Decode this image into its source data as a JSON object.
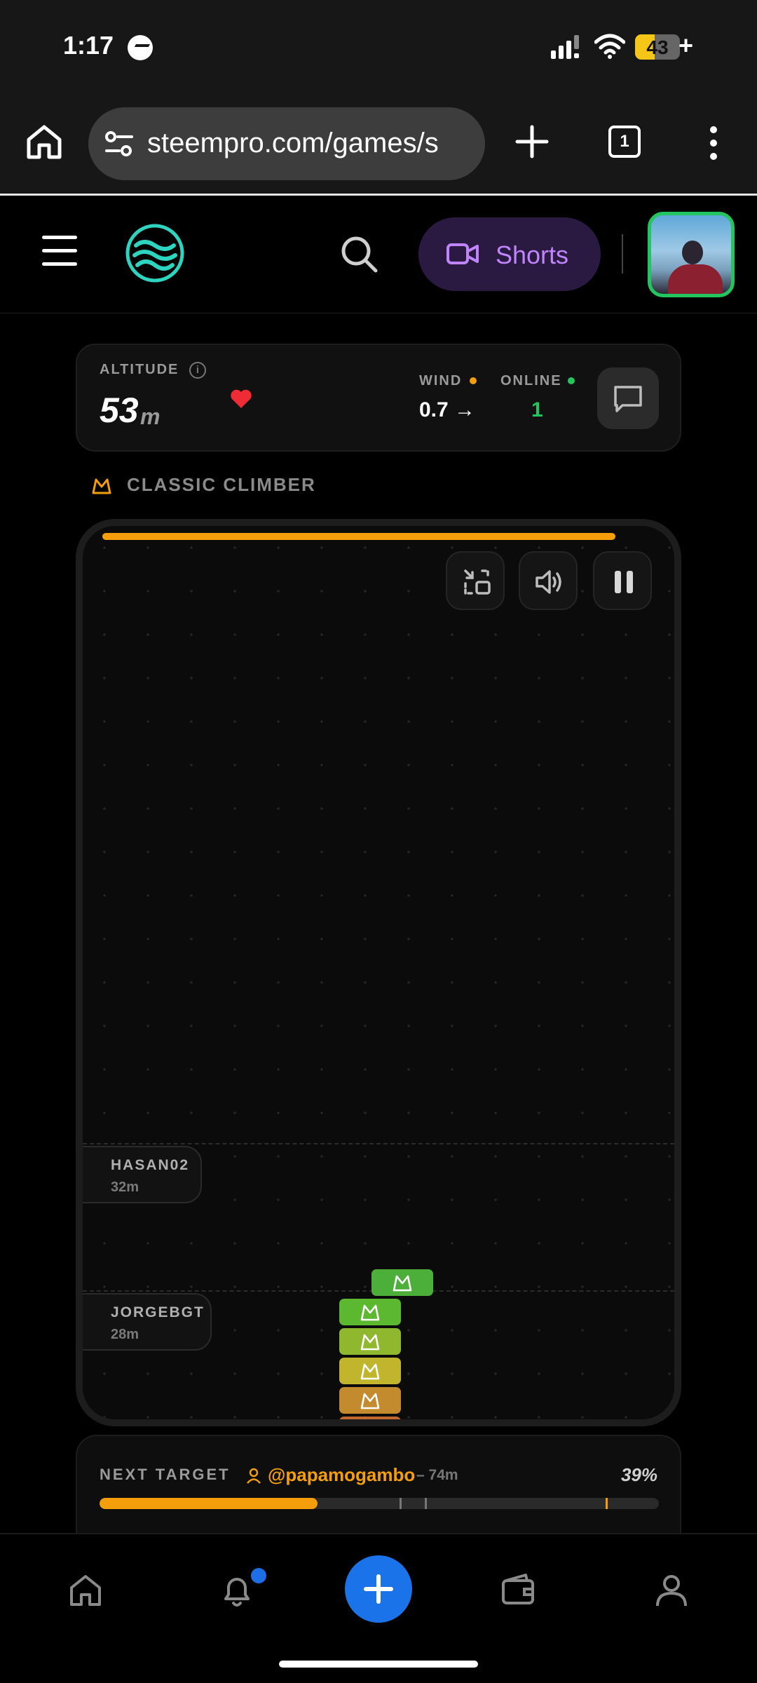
{
  "status_bar": {
    "time": "1:17",
    "battery": "43",
    "battery_suffix": "+"
  },
  "browser": {
    "url": "steempro.com/games/s",
    "tab_count": "1"
  },
  "header": {
    "shorts_label": "Shorts",
    "icons": [
      "menu-icon",
      "app-logo",
      "search-icon",
      "video-icon",
      "avatar"
    ]
  },
  "stats": {
    "altitude_label": "ALTITUDE",
    "altitude_value": "53",
    "altitude_unit": "m",
    "wind_label": "WIND",
    "wind_value": "0.7 →",
    "online_label": "ONLINE",
    "online_value": "1"
  },
  "mode": {
    "label": "CLASSIC CLIMBER"
  },
  "game": {
    "progress_fraction": 0.88,
    "markers": [
      {
        "name": "HASAN02",
        "distance": "32m"
      },
      {
        "name": "JORGEBGT",
        "distance": "28m"
      }
    ],
    "block_colors": [
      "#4caf3a",
      "#5cb82e",
      "#8fb82e",
      "#c2b52e",
      "#c48a2e",
      "#c2672e",
      "#c23030",
      "#c2305c",
      "#c23088",
      "#c030c0",
      "#8a30c8"
    ]
  },
  "next_target": {
    "label": "NEXT TARGET",
    "user": "@papamogambo",
    "distance": "– 74m",
    "percent": "39%",
    "progress_fraction": 0.39
  },
  "colors": {
    "accent": "#f59e0b",
    "online": "#22c55e",
    "fab": "#1a73e8",
    "shorts": "#c084fc"
  }
}
